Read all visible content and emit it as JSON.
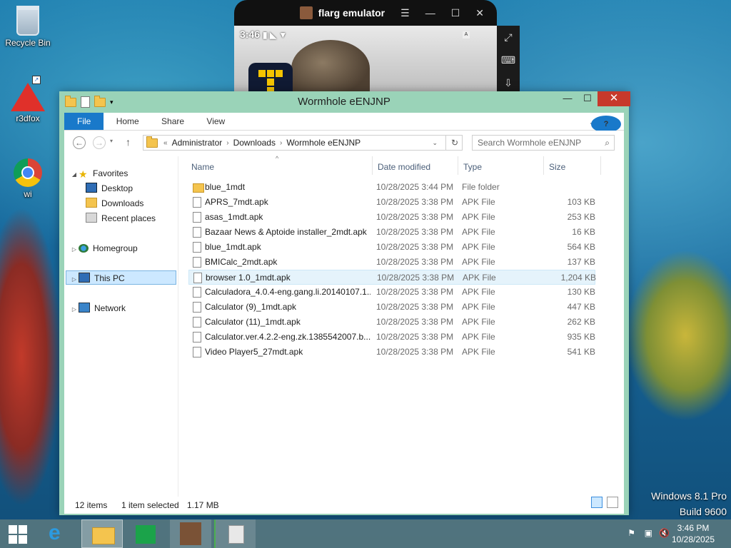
{
  "desktop": {
    "icons": [
      {
        "label": "Recycle Bin"
      },
      {
        "label": "r3dfox"
      },
      {
        "label": "wi"
      }
    ],
    "watermark_line1": "Windows 8.1 Pro",
    "watermark_line2": "Build 9600"
  },
  "emulator": {
    "title": "flarg emulator",
    "status_time": "3:46"
  },
  "explorer": {
    "title": "Wormhole eENJNP",
    "ribbon_tabs": {
      "file": "File",
      "home": "Home",
      "share": "Share",
      "view": "View"
    },
    "address": {
      "prefix": "«",
      "parts": [
        "Administrator",
        "Downloads",
        "Wormhole eENJNP"
      ]
    },
    "search_placeholder": "Search Wormhole eENJNP",
    "nav": {
      "favorites": "Favorites",
      "desktop": "Desktop",
      "downloads": "Downloads",
      "recent": "Recent places",
      "homegroup": "Homegroup",
      "thispc": "This PC",
      "network": "Network"
    },
    "columns": {
      "name": "Name",
      "date": "Date modified",
      "type": "Type",
      "size": "Size"
    },
    "files": [
      {
        "name": "blue_1mdt",
        "date": "10/28/2025 3:44 PM",
        "type": "File folder",
        "size": ""
      },
      {
        "name": "APRS_7mdt.apk",
        "date": "10/28/2025 3:38 PM",
        "type": "APK File",
        "size": "103 KB"
      },
      {
        "name": "asas_1mdt.apk",
        "date": "10/28/2025 3:38 PM",
        "type": "APK File",
        "size": "253 KB"
      },
      {
        "name": "Bazaar News & Aptoide installer_2mdt.apk",
        "date": "10/28/2025 3:38 PM",
        "type": "APK File",
        "size": "16 KB"
      },
      {
        "name": "blue_1mdt.apk",
        "date": "10/28/2025 3:38 PM",
        "type": "APK File",
        "size": "564 KB"
      },
      {
        "name": "BMICalc_2mdt.apk",
        "date": "10/28/2025 3:38 PM",
        "type": "APK File",
        "size": "137 KB"
      },
      {
        "name": "browser 1.0_1mdt.apk",
        "date": "10/28/2025 3:38 PM",
        "type": "APK File",
        "size": "1,204 KB"
      },
      {
        "name": "Calculadora_4.0.4-eng.gang.li.20140107.1...",
        "date": "10/28/2025 3:38 PM",
        "type": "APK File",
        "size": "130 KB"
      },
      {
        "name": "Calculator (9)_1mdt.apk",
        "date": "10/28/2025 3:38 PM",
        "type": "APK File",
        "size": "447 KB"
      },
      {
        "name": "Calculator (11)_1mdt.apk",
        "date": "10/28/2025 3:38 PM",
        "type": "APK File",
        "size": "262 KB"
      },
      {
        "name": "Calculator.ver.4.2.2-eng.zk.1385542007.b...",
        "date": "10/28/2025 3:38 PM",
        "type": "APK File",
        "size": "935 KB"
      },
      {
        "name": "Video Player5_27mdt.apk",
        "date": "10/28/2025 3:38 PM",
        "type": "APK File",
        "size": "541 KB"
      }
    ],
    "status": {
      "count": "12 items",
      "selected": "1 item selected",
      "size": "1.17 MB"
    }
  },
  "taskbar": {
    "time": "3:46 PM",
    "date": "10/28/2025"
  }
}
